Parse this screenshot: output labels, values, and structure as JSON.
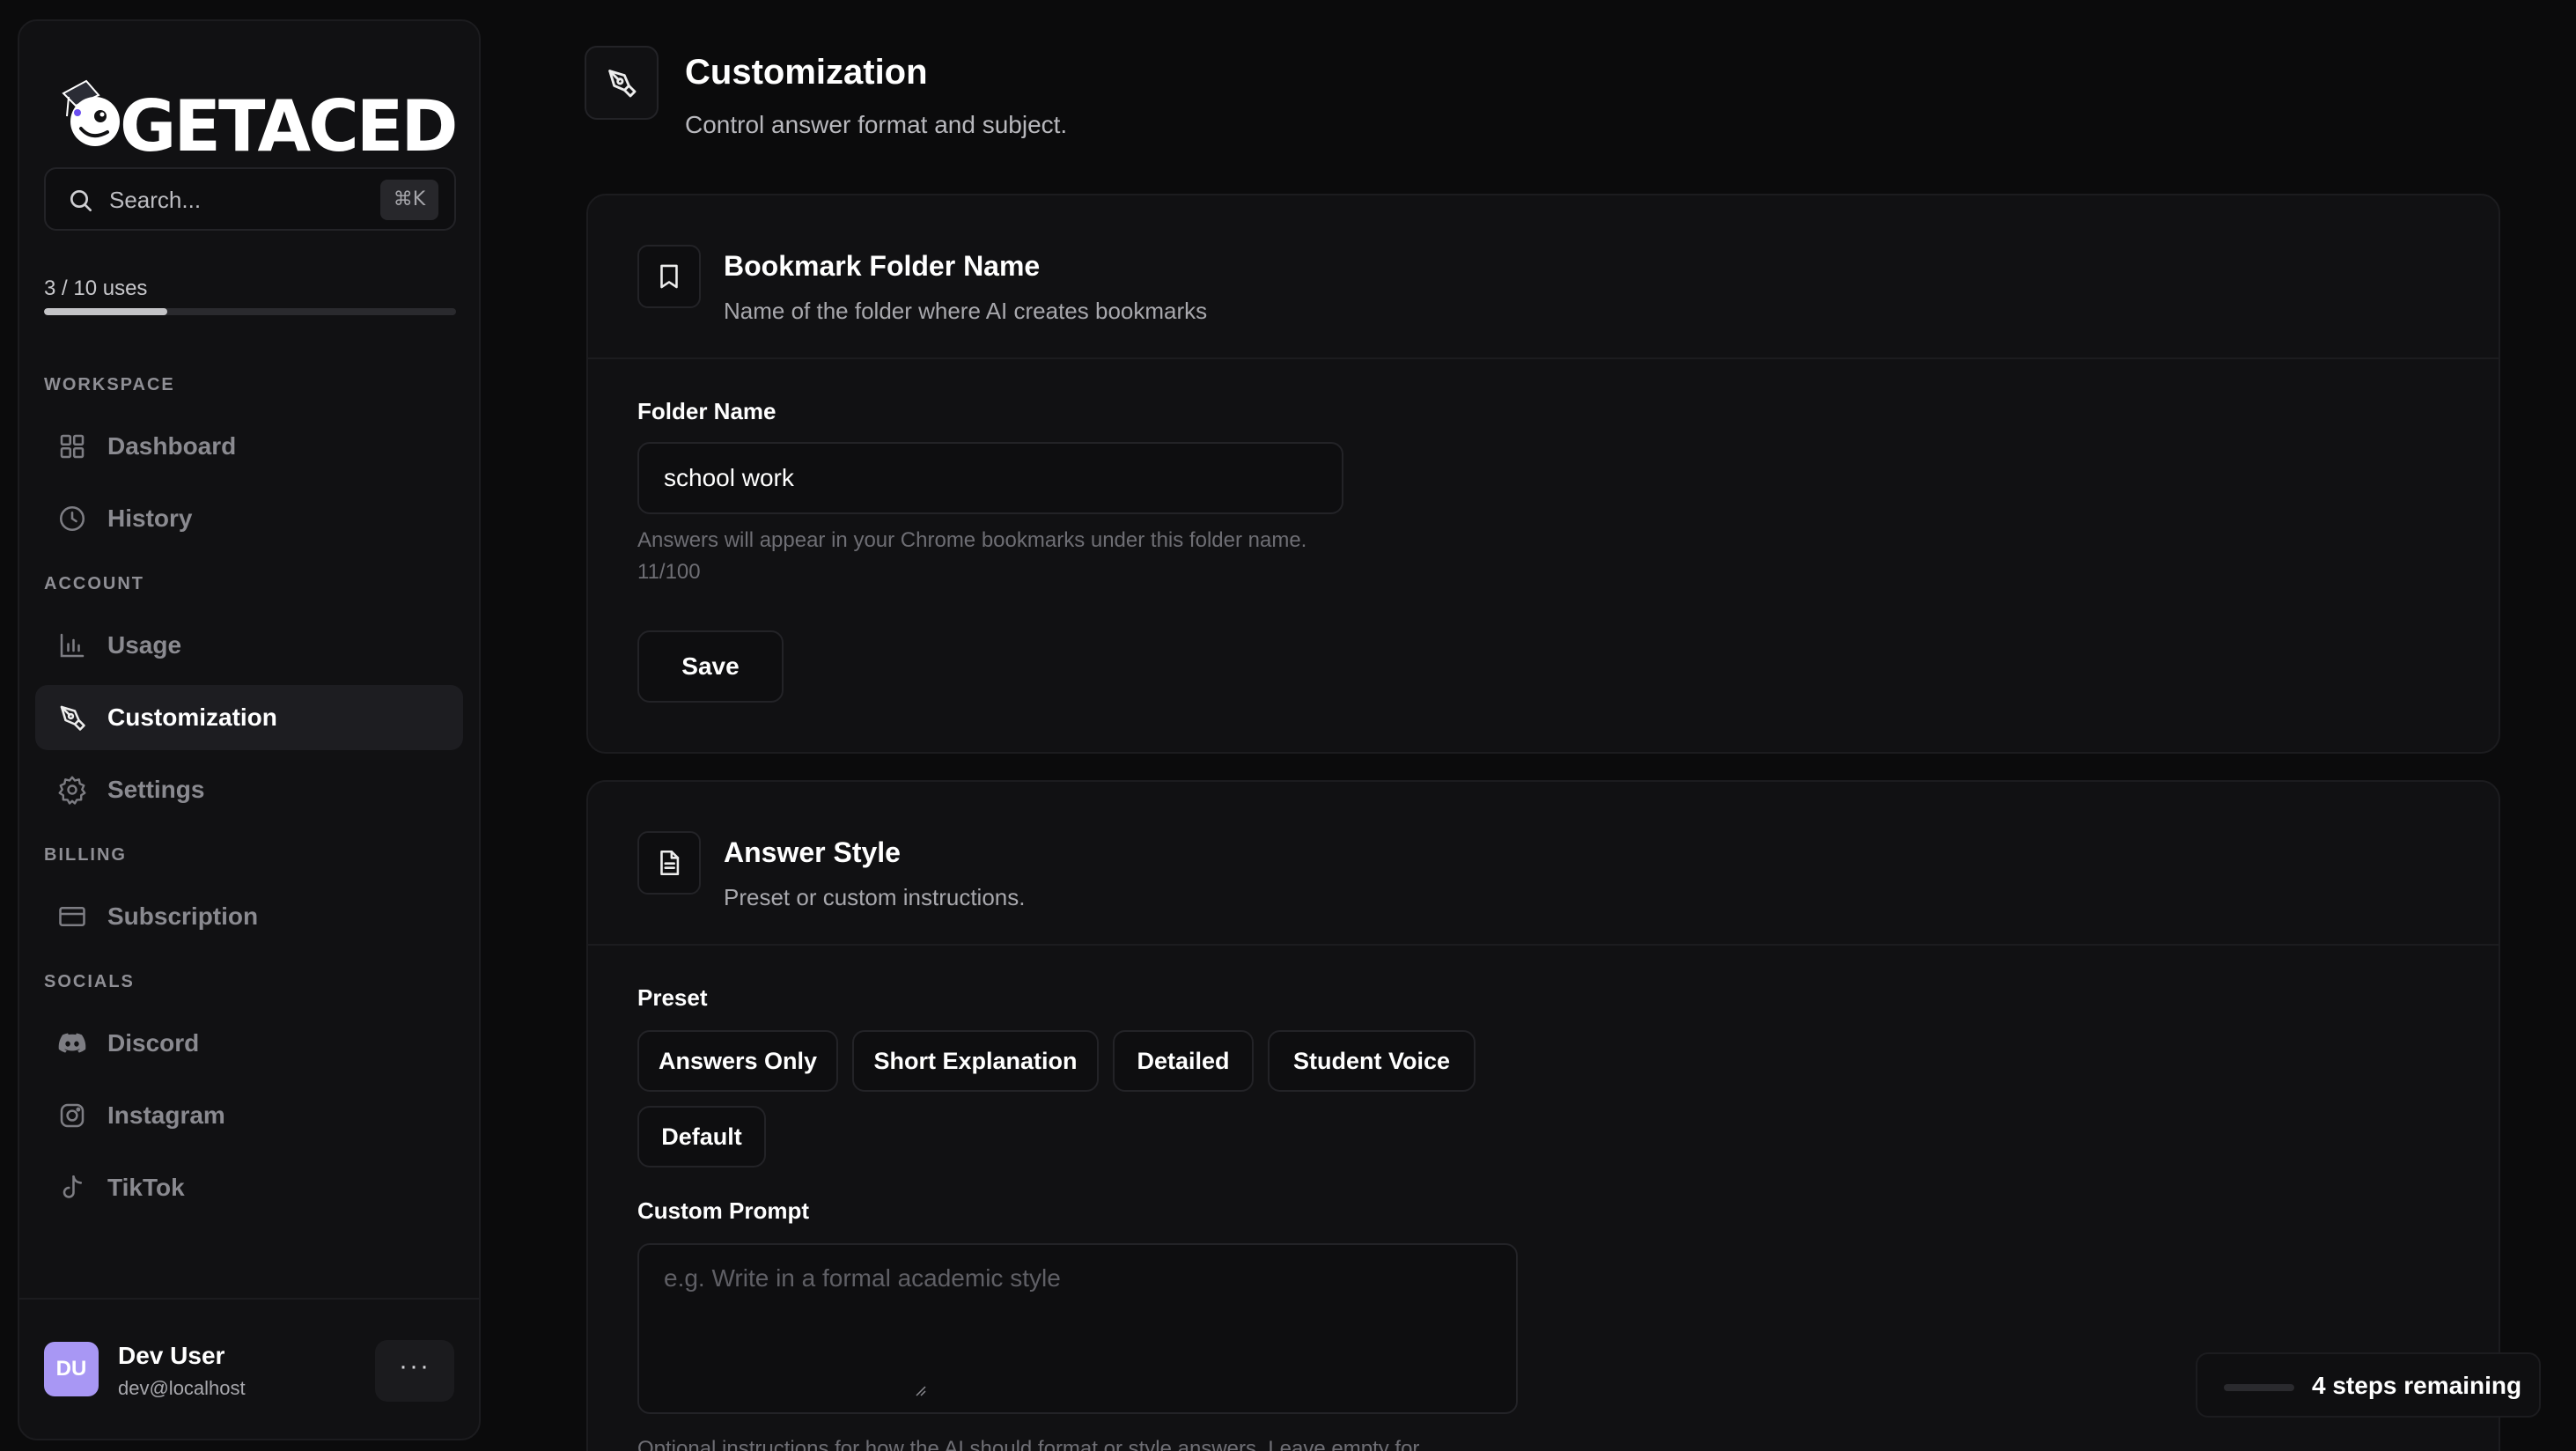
{
  "sidebar": {
    "logo_text": "GETACED",
    "search": {
      "placeholder": "Search...",
      "shortcut": "⌘K"
    },
    "usage": {
      "label": "3 / 10 uses",
      "used": 3,
      "total": 10
    },
    "sections": {
      "workspace": "WORKSPACE",
      "account": "ACCOUNT",
      "billing": "BILLING",
      "socials": "SOCIALS"
    },
    "items": {
      "dashboard": "Dashboard",
      "history": "History",
      "usage": "Usage",
      "customization": "Customization",
      "settings": "Settings",
      "subscription": "Subscription",
      "discord": "Discord",
      "instagram": "Instagram",
      "tiktok": "TikTok"
    },
    "active_item": "customization",
    "user": {
      "initials": "DU",
      "name": "Dev User",
      "email": "dev@localhost",
      "more_label": "···"
    }
  },
  "page": {
    "title": "Customization",
    "subtitle": "Control answer format and subject."
  },
  "bookmark_card": {
    "title": "Bookmark Folder Name",
    "description": "Name of the folder where AI creates bookmarks",
    "field_label": "Folder Name",
    "field_value": "school work",
    "help_text": "Answers will appear in your Chrome bookmarks under this folder name.",
    "char_count": "11/100",
    "save_label": "Save"
  },
  "answer_card": {
    "title": "Answer Style",
    "description": "Preset or custom instructions.",
    "preset_label": "Preset",
    "presets": {
      "answers_only": "Answers Only",
      "short_explanation": "Short Explanation",
      "detailed": "Detailed",
      "student_voice": "Student Voice",
      "default": "Default"
    },
    "custom_prompt_label": "Custom Prompt",
    "custom_prompt_placeholder": "e.g. Write in a formal academic style",
    "custom_prompt_help": "Optional instructions for how the AI should format or style answers. Leave empty for"
  },
  "onboarding": {
    "steps_remaining": "4 steps remaining"
  },
  "colors": {
    "accent_avatar": "#a897f4",
    "background": "#0b0b0c",
    "card": "#111113",
    "border": "#1c1c1f"
  }
}
